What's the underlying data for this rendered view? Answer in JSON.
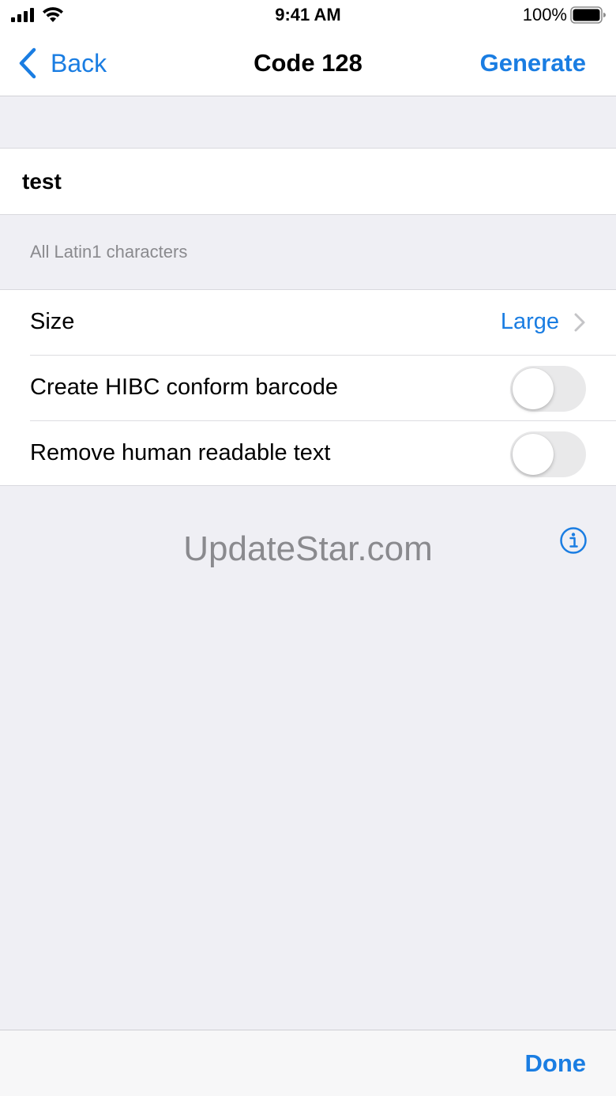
{
  "status_bar": {
    "time": "9:41 AM",
    "battery_percent": "100%"
  },
  "nav": {
    "back_label": "Back",
    "title": "Code 128",
    "action_label": "Generate"
  },
  "input": {
    "value": "test",
    "footnote": "All Latin1 characters"
  },
  "settings": {
    "size": {
      "label": "Size",
      "value": "Large"
    },
    "hibc": {
      "label": "Create HIBC conform barcode",
      "on": false
    },
    "remove_text": {
      "label": "Remove human readable text",
      "on": false
    }
  },
  "watermark": "UpdateStar.com",
  "toolbar": {
    "done_label": "Done"
  },
  "colors": {
    "accent": "#1a7de2",
    "background": "#efeff4",
    "secondary_text": "#8a8a8e"
  },
  "icons": [
    "cellular-signal-icon",
    "wifi-icon",
    "battery-icon",
    "chevron-left-icon",
    "chevron-right-icon",
    "info-icon"
  ]
}
